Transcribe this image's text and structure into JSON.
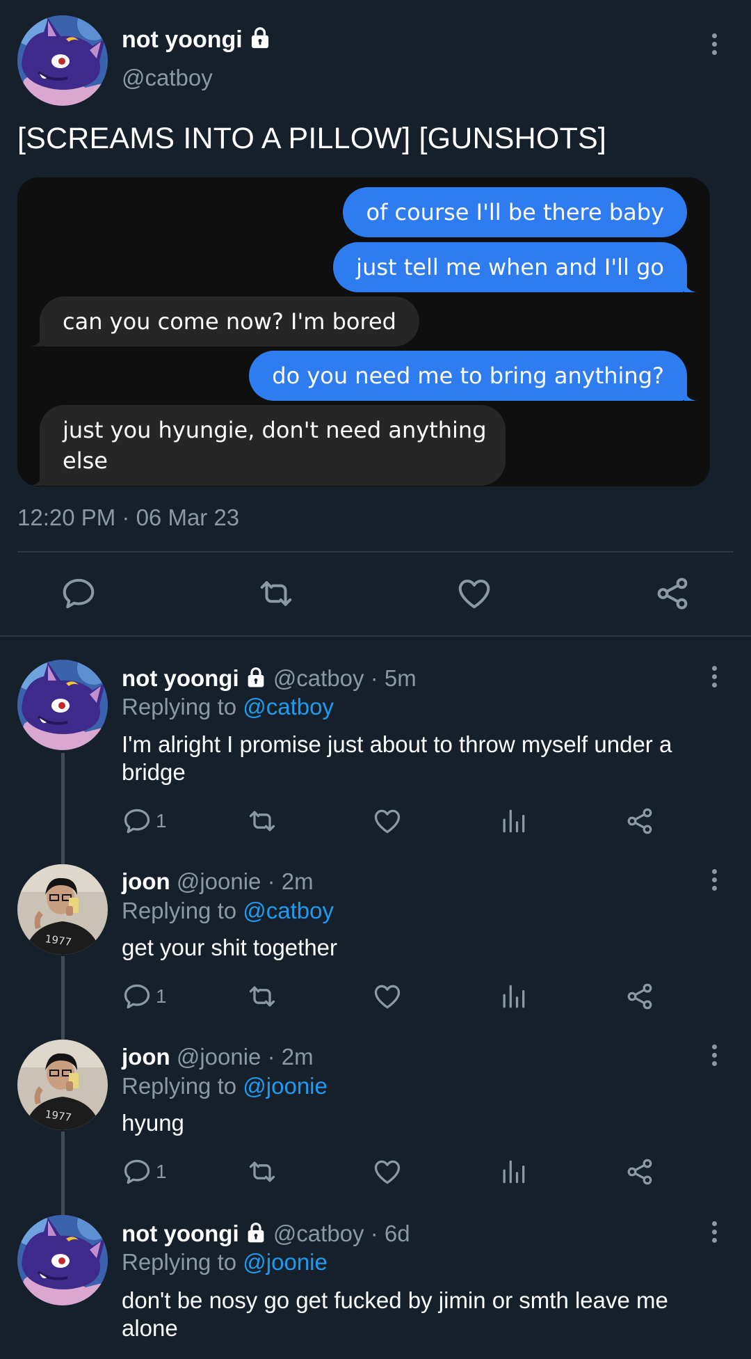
{
  "main_tweet": {
    "name": "not yoongi",
    "handle": "@catboy",
    "text": "[SCREAMS INTO A PILLOW] [GUNSHOTS]",
    "timestamp": "12:20 PM · 06 Mar 23",
    "messages": [
      {
        "side": "out",
        "text": "of course I'll be there baby"
      },
      {
        "side": "out",
        "text": "just tell me when and I'll go"
      },
      {
        "side": "in",
        "text": "can you come now? I'm bored"
      },
      {
        "side": "out",
        "text": "do you need me to bring anything?"
      },
      {
        "side": "in",
        "line1": "just you hyungie, don't need anything",
        "line2": "else"
      }
    ]
  },
  "replies": [
    {
      "name": "not yoongi",
      "meta": "@catboy · 5m",
      "replying_label": "Replying to",
      "replying_to": "@catboy",
      "line1": "I'm alright I promise just about to throw myself under a",
      "line2": "bridge",
      "reply_count": "1"
    },
    {
      "name": "joon",
      "meta": "@joonie · 2m",
      "replying_label": "Replying to",
      "replying_to": "@catboy",
      "line1": "get your shit together",
      "reply_count": "1"
    },
    {
      "name": "joon",
      "meta": "@joonie · 2m",
      "replying_label": "Replying to",
      "replying_to": "@joonie",
      "line1": "hyung",
      "reply_count": "1"
    },
    {
      "name": "not yoongi",
      "meta": "@catboy · 6d",
      "replying_label": "Replying to",
      "replying_to": "@joonie",
      "line1": "don't be nosy go get fucked by jimin or smth leave me",
      "line2": "alone"
    }
  ],
  "colors": {
    "background": "#16202b",
    "secondary_text": "#8b98a5",
    "mention": "#1d9bf0",
    "outgoing_bubble": "#2f7cf0",
    "incoming_bubble": "#262627"
  },
  "icons": [
    "lock-icon",
    "more-options-icon",
    "reply-icon",
    "retweet-icon",
    "like-icon",
    "share-icon",
    "analytics-icon"
  ]
}
